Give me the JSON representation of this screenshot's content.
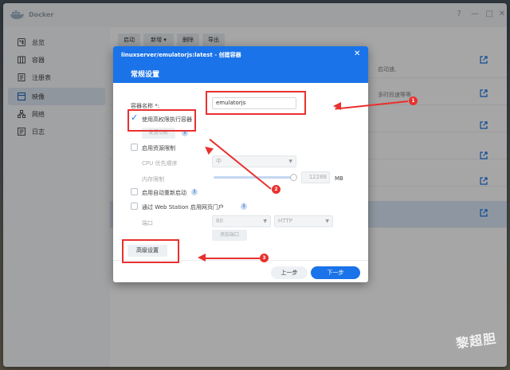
{
  "app": {
    "title": "Docker",
    "accent": "#1a73e8",
    "annotation_color": "#e8312f"
  },
  "sidebar": {
    "items": [
      {
        "label": "总览",
        "icon": "overview-icon"
      },
      {
        "label": "容器",
        "icon": "container-icon"
      },
      {
        "label": "注册表",
        "icon": "registry-icon"
      },
      {
        "label": "映像",
        "icon": "image-icon",
        "active": true
      },
      {
        "label": "网络",
        "icon": "network-icon"
      },
      {
        "label": "日志",
        "icon": "log-icon"
      }
    ]
  },
  "toolbar": {
    "start": "启动",
    "add": "新增",
    "delete": "删除",
    "export": "导出"
  },
  "background_text": {
    "line1": "启动速,",
    "line2": "多时段速等等"
  },
  "dialog": {
    "title": "linuxserver/emulatorjs:latest - 创建容器",
    "section": "常规设置",
    "container_name_label": "容器名称 *:",
    "container_name_value": "emulatorjs",
    "privileged_label": "使用高权限执行容器",
    "configure_button": "配置功能",
    "resource_limit_label": "启用资源限制",
    "cpu_priority_label": "CPU 优先顺序",
    "cpu_priority_value": "中",
    "memory_limit_label": "内存限制",
    "memory_value": "12288",
    "memory_unit": "MB",
    "auto_restart_label": "启用自动重新启动",
    "webstation_label": "通过 Web Station 启用网页门户",
    "port_label": "端口",
    "port_value": "80",
    "protocol_value": "HTTP",
    "add_port_button": "添加端口",
    "advanced_button": "高级设置",
    "prev_button": "上一步",
    "next_button": "下一步"
  },
  "annotations": {
    "one": "1",
    "two": "2",
    "three": "3"
  },
  "watermark": "黎超胆"
}
